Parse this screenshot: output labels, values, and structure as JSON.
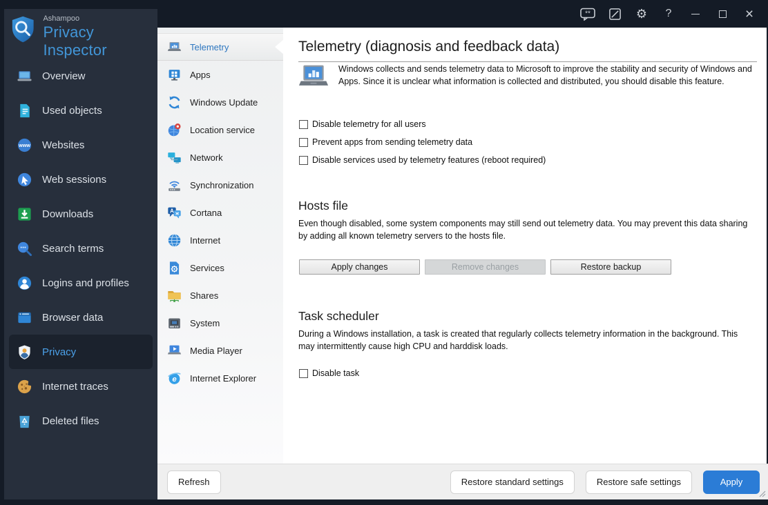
{
  "titlebar": {
    "brand": "Ashampoo",
    "app_name": "Privacy Inspector",
    "help_label": "?",
    "close_label": "×"
  },
  "sidebar": {
    "items": [
      {
        "label": "Overview",
        "selected": false
      },
      {
        "label": "Used objects",
        "selected": false
      },
      {
        "label": "Websites",
        "selected": false
      },
      {
        "label": "Web sessions",
        "selected": false
      },
      {
        "label": "Downloads",
        "selected": false
      },
      {
        "label": "Search terms",
        "selected": false
      },
      {
        "label": "Logins and profiles",
        "selected": false
      },
      {
        "label": "Browser data",
        "selected": false
      },
      {
        "label": "Privacy",
        "selected": true
      },
      {
        "label": "Internet traces",
        "selected": false
      },
      {
        "label": "Deleted files",
        "selected": false
      }
    ]
  },
  "subsidebar": {
    "items": [
      {
        "label": "Telemetry",
        "selected": true
      },
      {
        "label": "Apps",
        "selected": false
      },
      {
        "label": "Windows Update",
        "selected": false
      },
      {
        "label": "Location service",
        "selected": false
      },
      {
        "label": "Network",
        "selected": false
      },
      {
        "label": "Synchronization",
        "selected": false
      },
      {
        "label": "Cortana",
        "selected": false
      },
      {
        "label": "Internet",
        "selected": false
      },
      {
        "label": "Services",
        "selected": false
      },
      {
        "label": "Shares",
        "selected": false
      },
      {
        "label": "System",
        "selected": false
      },
      {
        "label": "Media Player",
        "selected": false
      },
      {
        "label": "Internet Explorer",
        "selected": false
      }
    ]
  },
  "content": {
    "title": "Telemetry (diagnosis and feedback data)",
    "intro": "Windows collects and sends telemetry data to Microsoft to improve the stability and security of Windows and Apps. Since it is unclear what information is collected and distributed, you should disable this feature.",
    "checkboxes": [
      {
        "label": "Disable telemetry for all users",
        "checked": false
      },
      {
        "label": "Prevent apps from sending telemetry data",
        "checked": false
      },
      {
        "label": "Disable services used by telemetry features (reboot required)",
        "checked": false
      }
    ],
    "hosts": {
      "heading": "Hosts file",
      "description": "Even though disabled, some system components may still send out telemetry data. You may prevent this data sharing by adding all known telemetry servers to the hosts file.",
      "buttons": [
        {
          "label": "Apply changes",
          "enabled": true
        },
        {
          "label": "Remove changes",
          "enabled": false
        },
        {
          "label": "Restore backup",
          "enabled": true
        }
      ]
    },
    "task": {
      "heading": "Task scheduler",
      "description": "During a Windows installation, a task is created that regularly collects telemetry information in the background. This may intermittently cause high CPU and harddisk loads.",
      "checkbox": {
        "label": "Disable task",
        "checked": false
      }
    }
  },
  "footer": {
    "refresh": "Refresh",
    "restore_standard": "Restore standard settings",
    "restore_safe": "Restore safe settings",
    "apply": "Apply"
  },
  "colors": {
    "accent": "#2b7cd6",
    "titlebar_bg": "#141b26",
    "sidebar_bg": "#272f3c",
    "sidebar_selected_text": "#4ba0e8",
    "subsidebar_selected_text": "#2e77c0"
  }
}
